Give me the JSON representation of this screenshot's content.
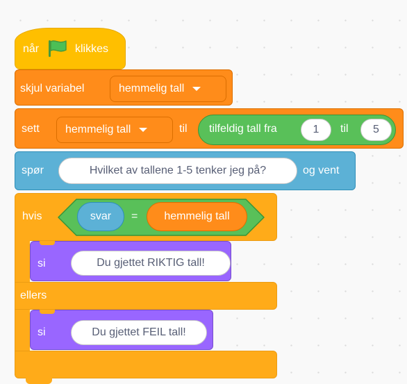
{
  "hat_block": {
    "label_before": "når",
    "flag_icon": "green-flag-icon",
    "label_after": "klikkes"
  },
  "hide_variable_block": {
    "label": "skjul variabel",
    "variable": "hemmelig tall"
  },
  "set_block": {
    "label": "sett",
    "variable": "hemmelig tall",
    "to_label": "til",
    "random": {
      "label": "tilfeldig tall fra",
      "from": "1",
      "to_label": "til",
      "to": "5"
    }
  },
  "ask_block": {
    "label": "spør",
    "question": "Hvilket av tallene 1-5 tenker jeg på?",
    "suffix": "og vent"
  },
  "if_block": {
    "label": "hvis",
    "condition": {
      "left": "svar",
      "operator": "=",
      "right": "hemmelig tall"
    },
    "then": {
      "label": "si",
      "message": "Du gjettet RIKTIG tall!"
    },
    "else_label": "ellers",
    "else": {
      "label": "si",
      "message": "Du gjettet FEIL tall!"
    }
  },
  "colors": {
    "events": "#ffbf00",
    "control": "#ffab19",
    "variables": "#ff8c1a",
    "sensing": "#5cb1d6",
    "looks": "#9966ff",
    "operators": "#59c059",
    "flag": "#4cbf56"
  }
}
